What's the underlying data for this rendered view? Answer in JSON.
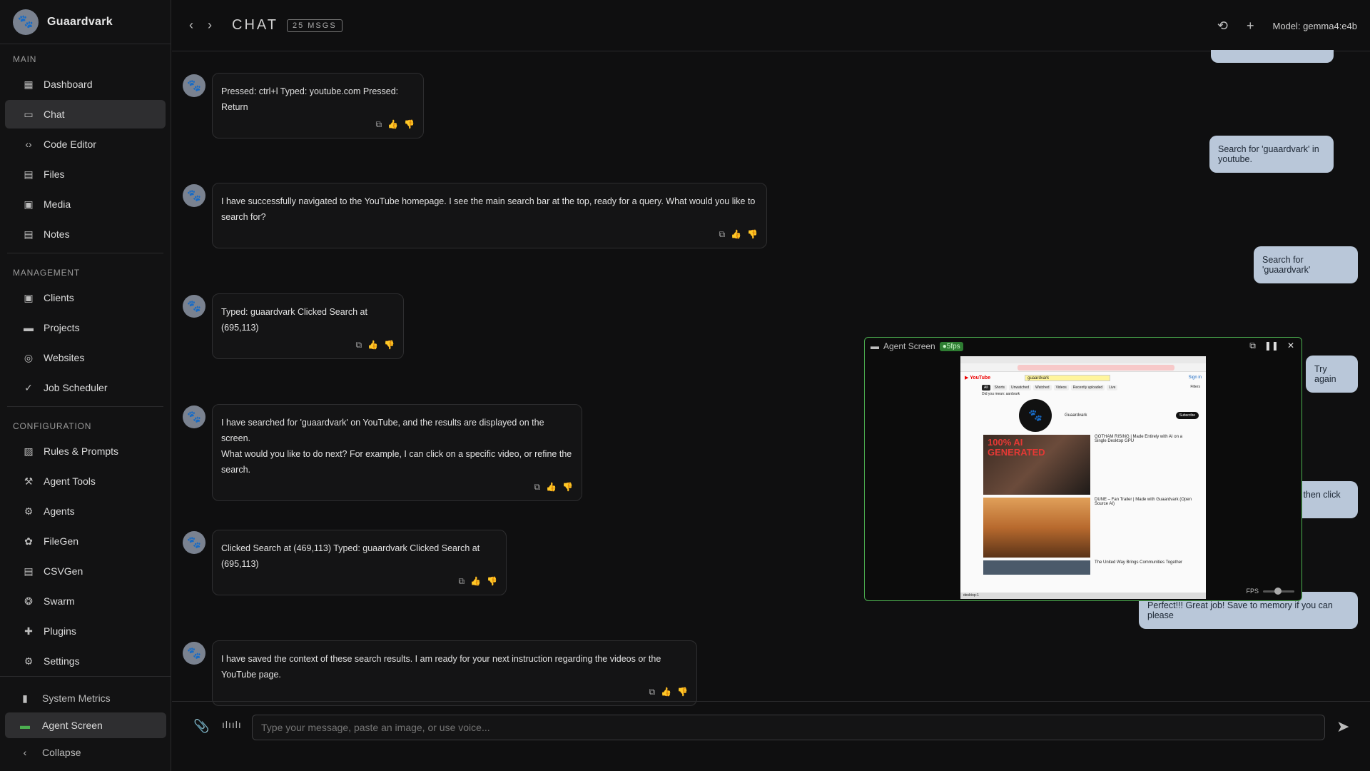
{
  "app": {
    "name": "Guaardvark"
  },
  "sidebar": {
    "sections": [
      {
        "label": "MAIN",
        "items": [
          {
            "label": "Dashboard",
            "icon": "dashboard-icon"
          },
          {
            "label": "Chat",
            "icon": "chat-icon",
            "active": true
          },
          {
            "label": "Code Editor",
            "icon": "code-icon"
          },
          {
            "label": "Files",
            "icon": "file-icon"
          },
          {
            "label": "Media",
            "icon": "image-icon"
          },
          {
            "label": "Notes",
            "icon": "note-icon"
          }
        ]
      },
      {
        "label": "MANAGEMENT",
        "items": [
          {
            "label": "Clients",
            "icon": "contact-icon"
          },
          {
            "label": "Projects",
            "icon": "folder-icon"
          },
          {
            "label": "Websites",
            "icon": "globe-icon"
          },
          {
            "label": "Job Scheduler",
            "icon": "check-circle-icon"
          }
        ]
      },
      {
        "label": "CONFIGURATION",
        "items": [
          {
            "label": "Rules & Prompts",
            "icon": "rules-icon"
          },
          {
            "label": "Agent Tools",
            "icon": "wrench-icon"
          },
          {
            "label": "Agents",
            "icon": "agent-icon"
          },
          {
            "label": "FileGen",
            "icon": "paw-icon"
          },
          {
            "label": "CSVGen",
            "icon": "table-icon"
          },
          {
            "label": "Swarm",
            "icon": "swarm-icon"
          },
          {
            "label": "Plugins",
            "icon": "puzzle-icon"
          },
          {
            "label": "Settings",
            "icon": "gear-icon"
          }
        ]
      }
    ],
    "bottom": [
      {
        "label": "System Metrics",
        "icon": "bar-chart-icon"
      },
      {
        "label": "Agent Screen",
        "icon": "monitor-icon",
        "active": true
      },
      {
        "label": "Collapse",
        "icon": "chevron-left-icon"
      }
    ]
  },
  "header": {
    "title": "CHAT",
    "badge": "25 MSGS",
    "model": "Model: gemma4:e4b"
  },
  "messages": {
    "assistant": [
      "Pressed: ctrl+l Typed: youtube.com Pressed: Return",
      "I have successfully navigated to the YouTube homepage. I see the main search bar at the top, ready for a query. What would you like to search for?",
      "Typed: guaardvark Clicked Search at (695,113)",
      "I have searched for 'guaardvark' on YouTube, and the results are displayed on the screen.",
      "What would you like to do next? For example, I can click on a specific video, or refine the search.",
      "Clicked Search at (469,113) Typed: guaardvark Clicked Search at (695,113)",
      "I have saved the context of these search results. I am ready for your next instruction regarding the videos or the YouTube page."
    ],
    "user": [
      "Search for 'guaardvark' in youtube.",
      "Search for 'guaardvark'",
      "Try again",
      "lick in the search box, then type the word, then click search",
      "Perfect!!! Great job! Save to memory if you can please"
    ]
  },
  "agent_screen": {
    "title": "Agent Screen",
    "fps_badge": "●5fps",
    "fps_label": "FPS",
    "yt": {
      "search": "guaardvark",
      "tabs": [
        "All",
        "Shorts",
        "Unwatched",
        "Watched",
        "Videos",
        "Recently uploaded",
        "Live"
      ],
      "filters": "Filters",
      "did_you_mean": "Did you mean: aardvark",
      "channel": "Guaardvark",
      "subscribe": "Subscribe",
      "signin": "Sign in",
      "v1_title": "GOTHAM RISING | Made Entirely with AI on a Single Desktop GPU",
      "v1_thumb": "100% AI GENERATED",
      "v2_title": "DUNE – Fan Trailer | Made with Guaardvark (Open Source AI)",
      "v3_title": "The United Way Brings Communities Together",
      "taskbar": "desktop-1"
    }
  },
  "composer": {
    "placeholder": "Type your message, paste an image, or use voice..."
  }
}
